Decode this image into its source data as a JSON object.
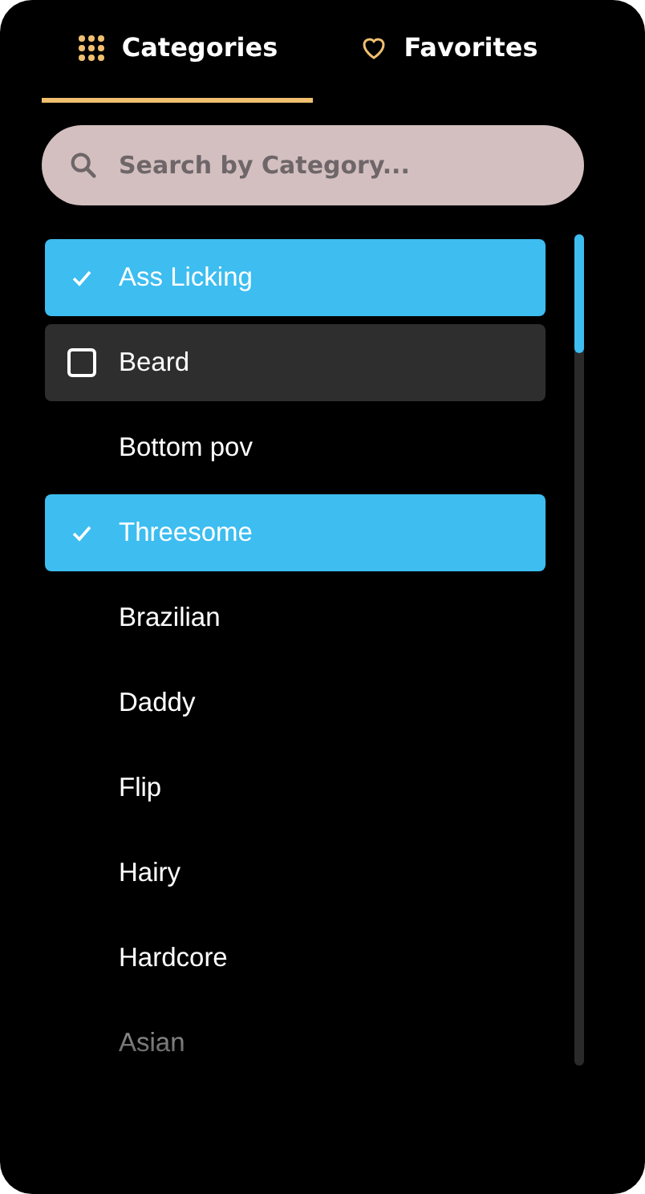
{
  "tabs": [
    {
      "label": "Categories",
      "selected": true
    },
    {
      "label": "Favorites",
      "selected": false
    }
  ],
  "search": {
    "placeholder": "Search by Category..."
  },
  "categories": [
    {
      "label": "Ass Licking",
      "selected": true,
      "focused": false
    },
    {
      "label": "Beard",
      "selected": false,
      "focused": true
    },
    {
      "label": "Bottom pov",
      "selected": false,
      "focused": false
    },
    {
      "label": "Threesome",
      "selected": true,
      "focused": false
    },
    {
      "label": "Brazilian",
      "selected": false,
      "focused": false
    },
    {
      "label": "Daddy",
      "selected": false,
      "focused": false
    },
    {
      "label": "Flip",
      "selected": false,
      "focused": false
    },
    {
      "label": "Hairy",
      "selected": false,
      "focused": false
    },
    {
      "label": "Hardcore",
      "selected": false,
      "focused": false
    },
    {
      "label": "Asian",
      "selected": false,
      "focused": false
    }
  ]
}
